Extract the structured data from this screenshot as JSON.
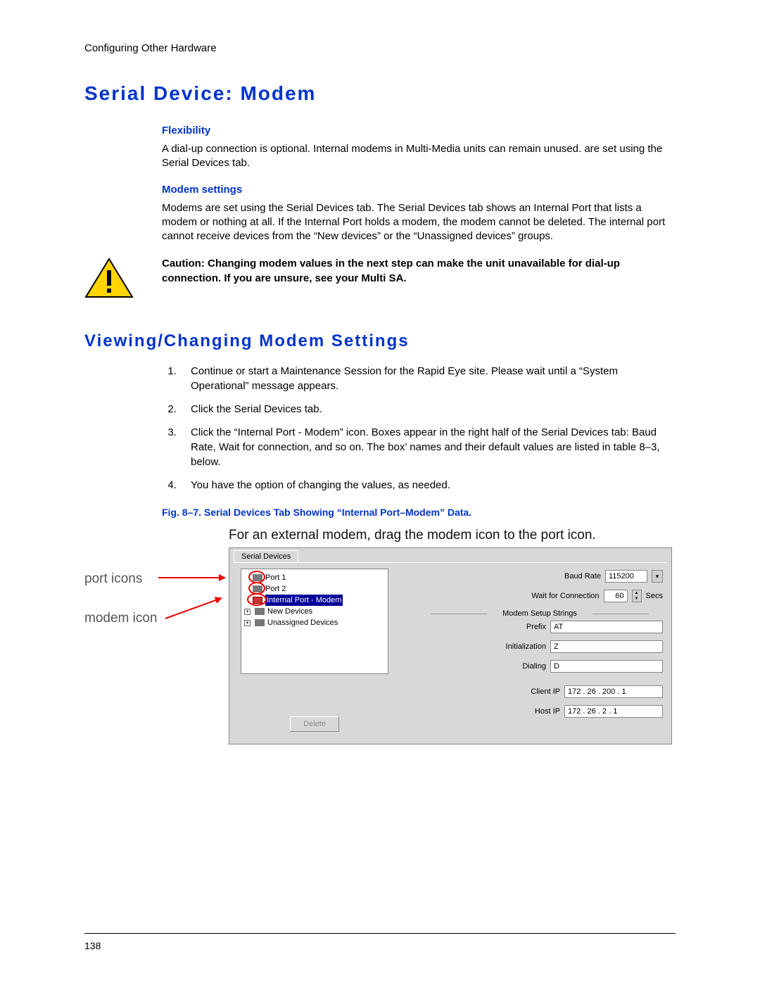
{
  "running_head": "Configuring Other Hardware",
  "h1": "Serial Device: Modem",
  "flex_h": "Flexibility",
  "flex_p": "A dial-up connection is optional. Internal modems in Multi-Media units can remain unused. are set using the Serial Devices tab.",
  "modem_h": "Modem settings",
  "modem_p": "Modems are set using the Serial Devices tab. The Serial Devices tab shows an Internal Port that lists a modem or nothing at all. If the Internal Port holds a modem, the modem cannot be deleted. The internal port cannot receive devices from the “New devices” or the “Unassigned devices” groups.",
  "caution": "Caution: Changing modem values in the next step can make the unit unavailable for dial-up connection. If you are unsure, see your Multi SA.",
  "h2": "Viewing/Changing Modem Settings",
  "steps": [
    "Continue or start a Maintenance Session for the Rapid Eye site. Please wait until a “System Operational” message appears.",
    "Click the Serial Devices tab.",
    "Click the “Internal Port - Modem” icon. Boxes appear in the right half of the Serial Devices tab: Baud Rate, Wait for connection, and so on. The box’ names and their default values are listed in table 8–3, below.",
    "You have the option of changing the values, as needed."
  ],
  "fig_cap": "Fig. 8–7.    Serial Devices Tab Showing “Internal Port–Modem” Data.",
  "fig_instruction": "For an external modem, drag the modem icon to the port icon.",
  "anno_port": "port icons",
  "anno_modem": "modem icon",
  "dialog": {
    "tab": "Serial Devices",
    "tree": {
      "port1": "Port 1",
      "port2": "Port 2",
      "internal": "Internal Port - Modem",
      "newdev": "New Devices",
      "unassigned": "Unassigned Devices"
    },
    "delete": "Delete",
    "fields": {
      "baud_l": "Baud Rate",
      "baud_v": "115200",
      "wait_l": "Wait for Connection",
      "wait_v": "60",
      "wait_unit": "Secs",
      "grp": "Modem Setup Strings",
      "prefix_l": "Prefix",
      "prefix_v": "AT",
      "init_l": "Initialization",
      "init_v": "Z",
      "dial_l": "Dialing",
      "dial_v": "D",
      "client_l": "Client IP",
      "client_v": "172 . 26 . 200 .   1",
      "host_l": "Host IP",
      "host_v": "172 . 26 .   2  .   1"
    }
  },
  "pagenum": "138"
}
